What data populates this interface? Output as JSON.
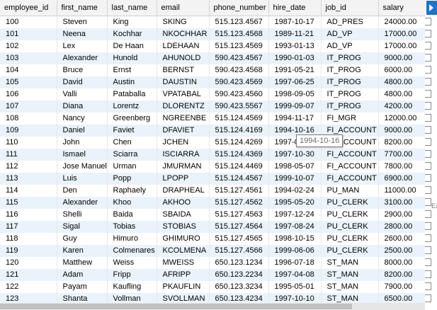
{
  "columns": [
    "employee_id",
    "first_name",
    "last_name",
    "email",
    "phone_number",
    "hire_date",
    "job_id",
    "salary"
  ],
  "rows": [
    [
      "100",
      "Steven",
      "King",
      "SKING",
      "515.123.4567",
      "1987-10-17",
      "AD_PRES",
      "24000.00"
    ],
    [
      "101",
      "Neena",
      "Kochhar",
      "NKOCHHAR",
      "515.123.4568",
      "1989-11-21",
      "AD_VP",
      "17000.00"
    ],
    [
      "102",
      "Lex",
      "De Haan",
      "LDEHAAN",
      "515.123.4569",
      "1993-01-13",
      "AD_VP",
      "17000.00"
    ],
    [
      "103",
      "Alexander",
      "Hunold",
      "AHUNOLD",
      "590.423.4567",
      "1990-01-03",
      "IT_PROG",
      "9000.00"
    ],
    [
      "104",
      "Bruce",
      "Ernst",
      "BERNST",
      "590.423.4568",
      "1991-05-21",
      "IT_PROG",
      "6000.00"
    ],
    [
      "105",
      "David",
      "Austin",
      "DAUSTIN",
      "590.423.4569",
      "1997-06-25",
      "IT_PROG",
      "4800.00"
    ],
    [
      "106",
      "Valli",
      "Pataballa",
      "VPATABAL",
      "590.423.4560",
      "1998-09-05",
      "IT_PROG",
      "4800.00"
    ],
    [
      "107",
      "Diana",
      "Lorentz",
      "DLORENTZ",
      "590.423.5567",
      "1999-09-07",
      "IT_PROG",
      "4200.00"
    ],
    [
      "108",
      "Nancy",
      "Greenberg",
      "NGREENBE",
      "515.124.4569",
      "1994-11-17",
      "FI_MGR",
      "12000.00"
    ],
    [
      "109",
      "Daniel",
      "Faviet",
      "DFAVIET",
      "515.124.4169",
      "1994-10-16",
      "FI_ACCOUNT",
      "9000.00"
    ],
    [
      "110",
      "John",
      "Chen",
      "JCHEN",
      "515.124.4269",
      "1997-09-28",
      "FI_ACCOUNT",
      "8200.00"
    ],
    [
      "111",
      "Ismael",
      "Sciarra",
      "ISCIARRA",
      "515.124.4369",
      "1997-10-30",
      "FI_ACCOUNT",
      "7700.00"
    ],
    [
      "112",
      "Jose Manuel",
      "Urman",
      "JMURMAN",
      "515.124.4469",
      "1998-05-07",
      "FI_ACCOUNT",
      "7800.00"
    ],
    [
      "113",
      "Luis",
      "Popp",
      "LPOPP",
      "515.124.4567",
      "1999-10-07",
      "FI_ACCOUNT",
      "6900.00"
    ],
    [
      "114",
      "Den",
      "Raphaely",
      "DRAPHEAL",
      "515.127.4561",
      "1994-02-24",
      "PU_MAN",
      "11000.00"
    ],
    [
      "115",
      "Alexander",
      "Khoo",
      "AKHOO",
      "515.127.4562",
      "1995-05-20",
      "PU_CLERK",
      "3100.00"
    ],
    [
      "116",
      "Shelli",
      "Baida",
      "SBAIDA",
      "515.127.4563",
      "1997-12-24",
      "PU_CLERK",
      "2900.00"
    ],
    [
      "117",
      "Sigal",
      "Tobias",
      "STOBIAS",
      "515.127.4564",
      "1997-08-24",
      "PU_CLERK",
      "2800.00"
    ],
    [
      "118",
      "Guy",
      "Himuro",
      "GHIMURO",
      "515.127.4565",
      "1998-10-15",
      "PU_CLERK",
      "2600.00"
    ],
    [
      "119",
      "Karen",
      "Colmenares",
      "KCOLMENA",
      "515.127.4566",
      "1999-06-06",
      "PU_CLERK",
      "2500.00"
    ],
    [
      "120",
      "Matthew",
      "Weiss",
      "MWEISS",
      "650.123.1234",
      "1996-07-18",
      "ST_MAN",
      "8000.00"
    ],
    [
      "121",
      "Adam",
      "Fripp",
      "AFRIPP",
      "650.123.2234",
      "1997-04-08",
      "ST_MAN",
      "8200.00"
    ],
    [
      "122",
      "Payam",
      "Kaufling",
      "PKAUFLIN",
      "650.123.3234",
      "1995-05-01",
      "ST_MAN",
      "7900.00"
    ],
    [
      "123",
      "Shanta",
      "Vollman",
      "SVOLLMAN",
      "650.123.4234",
      "1997-10-10",
      "ST_MAN",
      "6500.00"
    ]
  ],
  "tooltip": "1994-10-16",
  "side_label": "Ex"
}
